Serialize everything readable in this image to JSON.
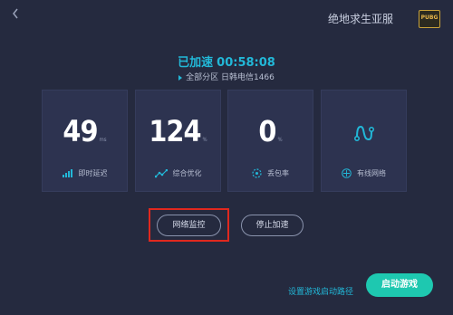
{
  "header": {
    "back_icon": "chevron-left-icon",
    "game_name": "绝地求生亚服",
    "game_logo_text": "PUBG"
  },
  "status": {
    "state": "已加速",
    "timer": "00:58:08",
    "server": "全部分区 日韩电信1466"
  },
  "stats": [
    {
      "value": "49",
      "unit": "ms",
      "label": "即时延迟",
      "icon": "signal-bars-icon"
    },
    {
      "value": "124",
      "unit": "%",
      "label": "综合优化",
      "icon": "trend-icon"
    },
    {
      "value": "0",
      "unit": "%",
      "label": "丢包率",
      "icon": "packet-loss-icon"
    },
    {
      "value": "",
      "unit": "",
      "label": "有线网络",
      "icon": "wired-network-icon"
    }
  ],
  "actions": {
    "monitor_label": "网络监控",
    "stop_label": "停止加速"
  },
  "footer": {
    "set_path_label": "设置游戏启动路径",
    "start_label": "启动游戏"
  },
  "colors": {
    "background": "#252a3f",
    "card": "#2d3350",
    "accent": "#22b8d8",
    "start_button": "#1ec8b0",
    "highlight": "#e0281e"
  }
}
